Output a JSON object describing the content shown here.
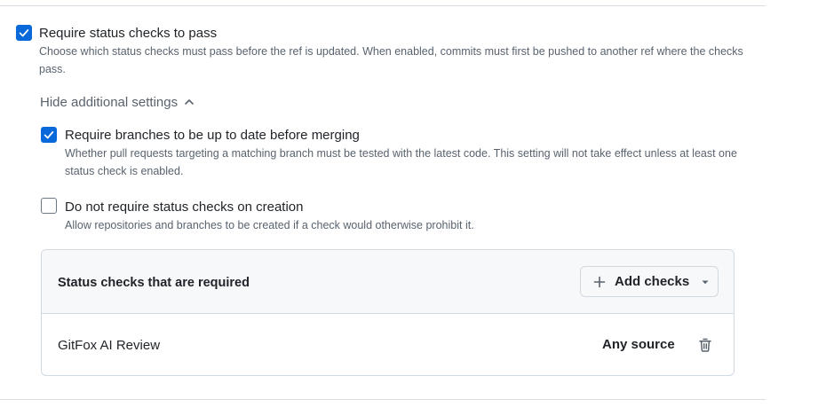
{
  "require_status_checks": {
    "checked": true,
    "label": "Require status checks to pass",
    "description": "Choose which status checks must pass before the ref is updated. When enabled, commits must first be pushed to another ref where the checks pass."
  },
  "additional_settings_toggle": {
    "label": "Hide additional settings",
    "icon": "chevron-up-icon"
  },
  "require_up_to_date": {
    "checked": true,
    "label": "Require branches to be up to date before merging",
    "description": "Whether pull requests targeting a matching branch must be tested with the latest code. This setting will not take effect unless at least one status check is enabled."
  },
  "skip_on_creation": {
    "checked": false,
    "label": "Do not require status checks on creation",
    "description": "Allow repositories and branches to be created if a check would otherwise prohibit it."
  },
  "required_checks": {
    "title": "Status checks that are required",
    "add_button": {
      "label": "Add checks",
      "icon": "plus-icon",
      "dropdown_icon": "triangle-down-icon"
    },
    "items": [
      {
        "name": "GitFox AI Review",
        "source": "Any source",
        "delete_icon": "trash-icon"
      }
    ]
  },
  "colors": {
    "accent": "#0969da",
    "text": "#1f2328",
    "muted": "#59636e",
    "border": "#d1d9e0",
    "header_bg": "#f6f8fa"
  }
}
